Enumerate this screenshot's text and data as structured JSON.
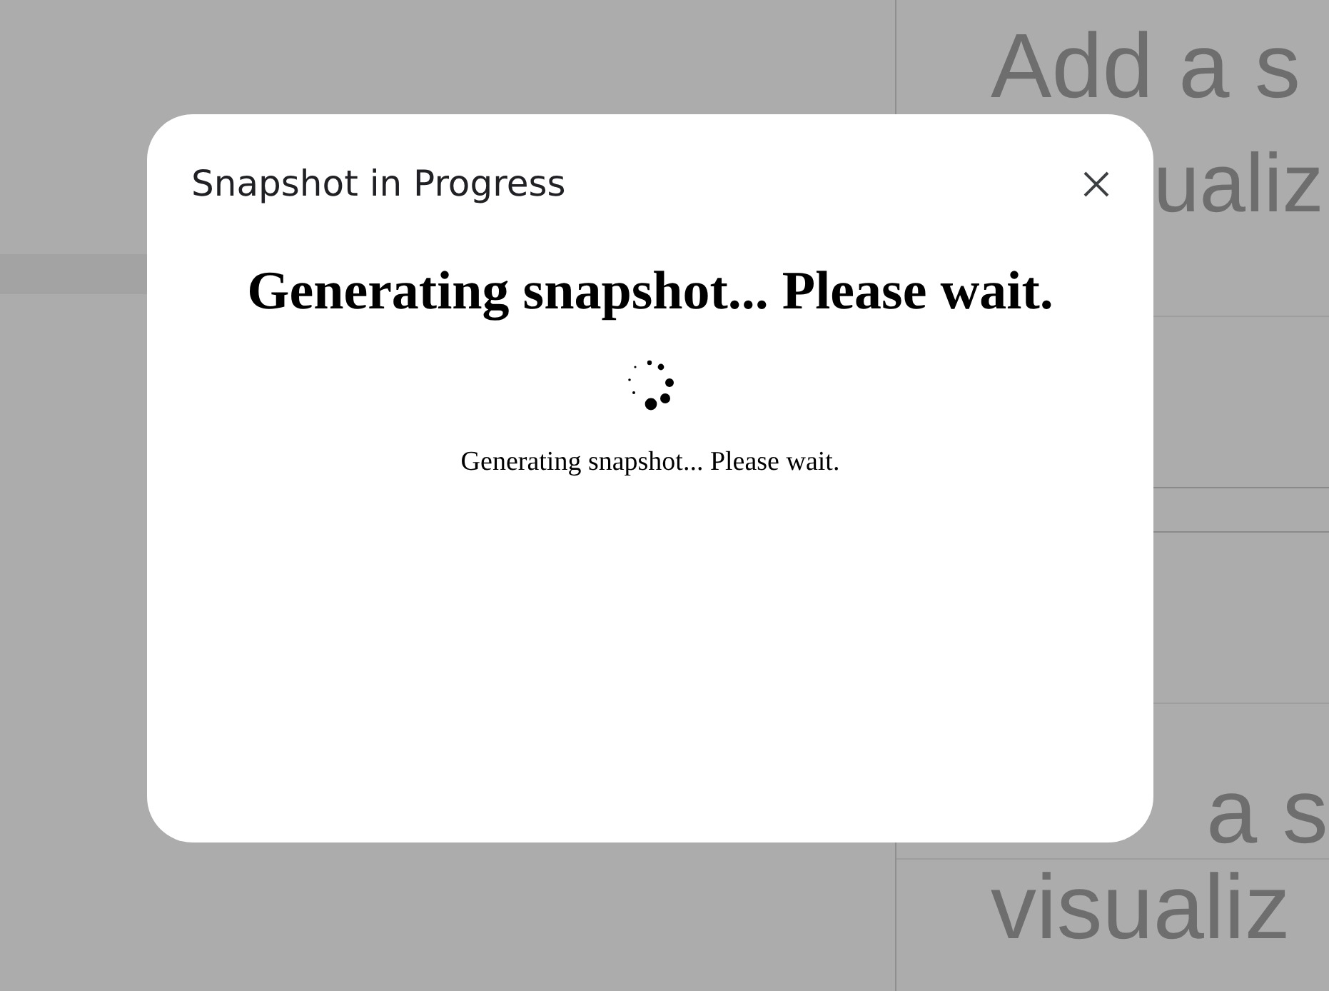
{
  "background": {
    "texts": [
      "Add a s",
      "ualiz",
      "a s",
      "visualiz"
    ]
  },
  "dialog": {
    "title": "Snapshot in Progress",
    "heading": "Generating snapshot... Please wait.",
    "message": "Generating snapshot... Please wait."
  }
}
